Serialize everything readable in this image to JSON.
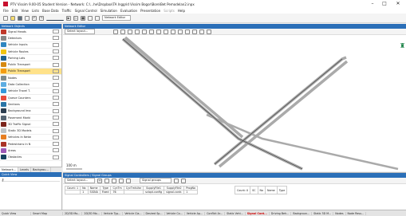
{
  "window": {
    "title": "PTV Vissim 9.00-05 Student Version - Network: C:\\...he\\Dropbox\\TA Inggrid Vissim Bogor\\Bore\\Bet Pemodelan2.inpx",
    "min_glyph": "–",
    "max_glyph": "□",
    "close_glyph": "✕"
  },
  "menu": [
    "File",
    "Edit",
    "View",
    "Lists",
    "Base Data",
    "Traffic",
    "Signal Control",
    "Simulation",
    "Evaluation",
    "Presentation",
    "Scripts",
    "Help"
  ],
  "toolbar": {
    "network_editor_combo": "Network Editor"
  },
  "network_objects": {
    "header": "Network Objects",
    "items": [
      {
        "label": "Signal Heads",
        "color": "#c0392b"
      },
      {
        "label": "Detectors",
        "color": "#888888"
      },
      {
        "label": "Vehicle Inputs",
        "color": "#2e86c1"
      },
      {
        "label": "Vehicle Routes",
        "color": "#f1c40f"
      },
      {
        "label": "Parking Lots",
        "color": "#1f618d"
      },
      {
        "label": "Public Transport",
        "color": "#d68910"
      },
      {
        "label": "Public Transport",
        "color": "#f39c12"
      },
      {
        "label": "Nodes",
        "color": "#7f8c8d"
      },
      {
        "label": "Data Collection",
        "color": "#5dade2"
      },
      {
        "label": "Vehicle Travel T.",
        "color": "#3498db"
      },
      {
        "label": "Queue Counters",
        "color": "#e74c3c"
      },
      {
        "label": "Sections",
        "color": "#2874a6"
      },
      {
        "label": "Background Ima",
        "color": "#2c3e50"
      },
      {
        "label": "Pavement Marki",
        "color": "#566573"
      },
      {
        "label": "3D Traffic Signal",
        "color": "#7b241c"
      },
      {
        "label": "Static 3D Models",
        "color": "#bdc3c7"
      },
      {
        "label": "Vehicles In Netw",
        "color": "#e67e22"
      },
      {
        "label": "Pedestrians In N",
        "color": "#a93226"
      },
      {
        "label": "Areas",
        "color": "#9b59b6"
      },
      {
        "label": "Obstacles",
        "color": "#154360"
      }
    ],
    "selected_index": 6,
    "tabs": [
      "Network...",
      "Levels",
      "Backgrou..."
    ]
  },
  "quick_view": {
    "header": "Quick View"
  },
  "network_editor": {
    "header": "Network Editor",
    "layout_combo": "Select layout...",
    "scale_label": "100 m"
  },
  "signal_pane": {
    "header": "Signal Controllers / Signal Groups",
    "layout_combo": "Select layout...",
    "groups_combo": "Signal groups",
    "count_label": "Count: 1",
    "columns": [
      "No",
      "Name",
      "Type",
      "CycTm",
      "CycTmIsVar",
      "SupplyFile1",
      "SupplyFile2",
      "ProgNo"
    ],
    "row": [
      "1",
      "SIGNA",
      "Fixed",
      "76",
      "",
      "sclopt.config",
      "signal.contr.",
      "1"
    ],
    "right_count": "Count: 0",
    "right_columns": [
      "SC",
      "No",
      "Name",
      "Type"
    ]
  },
  "bottom_tabs": [
    "2D/3D Mo...",
    "2D/3D Mo...",
    "Vehicle Typ...",
    "Vehicle Cla...",
    "Desired Sp...",
    "Vehicle Co...",
    "Vehicle Ap...",
    "Conflict Ar...",
    "Static Vehi...",
    "Signal Cont...",
    "Driving Beh...",
    "Backgroun...",
    "Static 3D M...",
    "Nodes",
    "Node Resu..."
  ],
  "bottom_active_index": 9
}
